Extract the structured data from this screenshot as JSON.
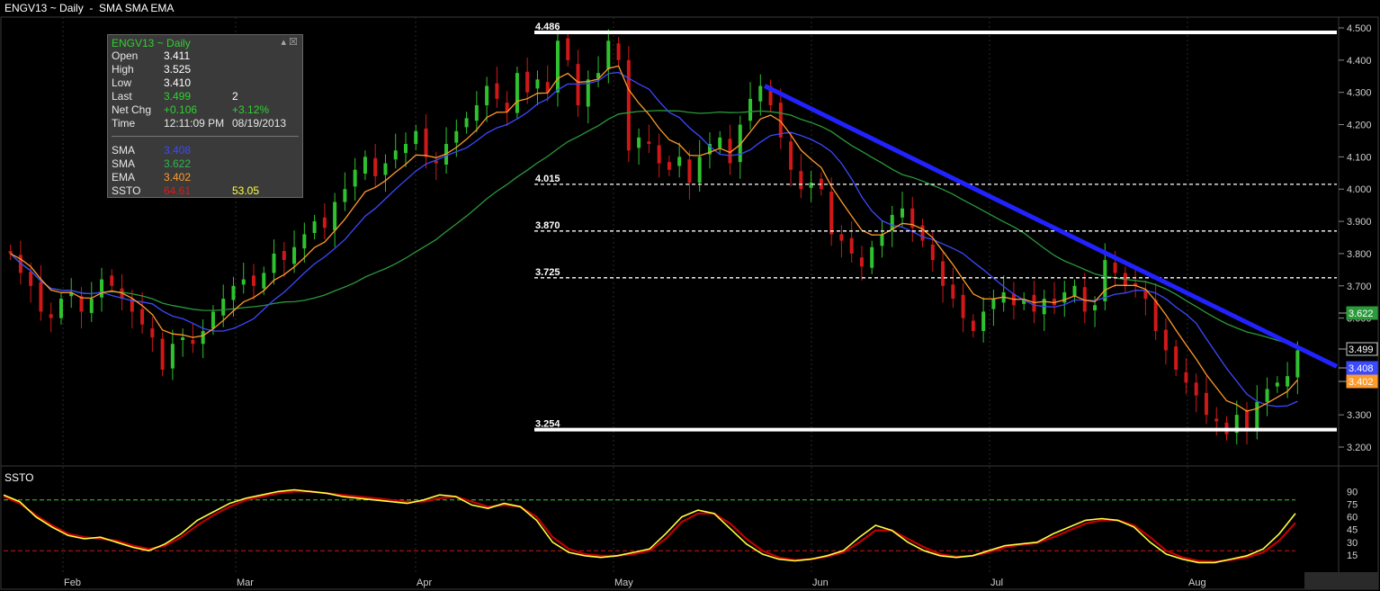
{
  "header": {
    "title": "ENGV13 ~ Daily  -  SMA SMA EMA"
  },
  "info_panel": {
    "title": "ENGV13 ~ Daily",
    "controls": "▴ ☒",
    "rows": [
      {
        "label": "Open",
        "value": "3.411",
        "extra": "",
        "color": "#ffffff"
      },
      {
        "label": "High",
        "value": "3.525",
        "extra": "",
        "color": "#ffffff"
      },
      {
        "label": "Low",
        "value": "3.410",
        "extra": "",
        "color": "#ffffff"
      },
      {
        "label": "Last",
        "value": "3.499",
        "extra": "2",
        "color": "#2fd02f"
      },
      {
        "label": "Net Chg",
        "value": "+0.106",
        "extra": "+3.12%",
        "color": "#2fd02f"
      },
      {
        "label": "Time",
        "value": "12:11:09 PM",
        "extra": "08/19/2013",
        "color": "#e6e6e6"
      }
    ],
    "studies": [
      {
        "label": "SMA",
        "value": "3.408",
        "extra": "",
        "color": "#3b49ff"
      },
      {
        "label": "SMA",
        "value": "3.622",
        "extra": "",
        "color": "#2fb84a"
      },
      {
        "label": "EMA",
        "value": "3.402",
        "extra": "",
        "color": "#ff9a2a"
      },
      {
        "label": "SSTO",
        "value": "64.61",
        "extra": "53.05",
        "color": "#e01818",
        "extra_color": "#ffff40"
      }
    ]
  },
  "subchart": {
    "title": "SSTO"
  },
  "colors": {
    "up": "#2fc22f",
    "down": "#d01818",
    "sma_fast": "#3b49ff",
    "sma_slow": "#2a9a3a",
    "ema": "#ff9a2a",
    "ssto_k": "#c00000",
    "ssto_d": "#ffff40",
    "trend": "#2222ff"
  },
  "chart_data": [
    {
      "type": "candlestick",
      "title": "ENGV13 ~ Daily",
      "x_labels": [
        "Feb",
        "Mar",
        "Apr",
        "May",
        "Jun",
        "Jul",
        "Aug"
      ],
      "ylim": [
        3.14,
        4.54
      ],
      "y_ticks": [
        "4.500",
        "4.400",
        "4.300",
        "4.200",
        "4.100",
        "4.000",
        "3.900",
        "3.800",
        "3.700",
        "3.600",
        "3.300",
        "3.200"
      ],
      "ohlc_close_approx": [
        3.8,
        3.74,
        3.7,
        3.62,
        3.6,
        3.66,
        3.68,
        3.62,
        3.66,
        3.72,
        3.7,
        3.66,
        3.62,
        3.58,
        3.54,
        3.44,
        3.52,
        3.54,
        3.52,
        3.56,
        3.62,
        3.66,
        3.7,
        3.72,
        3.7,
        3.74,
        3.8,
        3.78,
        3.82,
        3.86,
        3.9,
        3.88,
        3.96,
        4.0,
        4.06,
        4.1,
        4.04,
        4.08,
        4.12,
        4.14,
        4.18,
        4.1,
        4.08,
        4.14,
        4.18,
        4.22,
        4.26,
        4.32,
        4.28,
        4.24,
        4.36,
        4.3,
        4.34,
        4.3,
        4.46,
        4.4,
        4.26,
        4.34,
        4.36,
        4.46,
        4.4,
        4.12,
        4.16,
        4.14,
        4.08,
        4.06,
        4.1,
        4.02,
        4.1,
        4.14,
        4.16,
        4.08,
        4.2,
        4.28,
        4.32,
        4.26,
        4.16,
        4.06,
        4.0,
        4.02,
        4.0,
        3.86,
        3.84,
        3.8,
        3.76,
        3.82,
        3.86,
        3.92,
        3.94,
        3.88,
        3.84,
        3.78,
        3.7,
        3.66,
        3.6,
        3.56,
        3.62,
        3.66,
        3.68,
        3.64,
        3.66,
        3.62,
        3.66,
        3.64,
        3.68,
        3.7,
        3.62,
        3.64,
        3.78,
        3.74,
        3.7,
        3.7,
        3.66,
        3.56,
        3.5,
        3.44,
        3.4,
        3.36,
        3.3,
        3.28,
        3.24,
        3.3,
        3.26,
        3.34,
        3.38,
        3.4,
        3.42,
        3.5
      ],
      "series": [
        {
          "name": "SMA",
          "last": 3.408
        },
        {
          "name": "SMA",
          "last": 3.622
        },
        {
          "name": "EMA",
          "last": 3.402
        }
      ],
      "horizontal_levels": [
        {
          "value": 4.486,
          "label": "4.486",
          "style": "solid"
        },
        {
          "value": 4.015,
          "label": "4.015",
          "style": "dashed"
        },
        {
          "value": 3.87,
          "label": "3.870",
          "style": "dashed"
        },
        {
          "value": 3.725,
          "label": "3.725",
          "style": "dashed"
        },
        {
          "value": 3.254,
          "label": "3.254",
          "style": "solid"
        }
      ],
      "last_value_tags": [
        {
          "label": "3.622",
          "value": 3.622,
          "color": "#2a9a3a"
        },
        {
          "label": "3.499",
          "value": 3.499,
          "color": "#000000"
        },
        {
          "label": "3.408",
          "value": 3.408,
          "color": "#3b49ff"
        },
        {
          "label": "3.402",
          "value": 3.402,
          "color": "#ff9a2a"
        }
      ],
      "trendline": {
        "from": [
          "May",
          4.32
        ],
        "to": [
          "Aug",
          3.46
        ]
      }
    },
    {
      "type": "line",
      "title": "SSTO",
      "ylim": [
        0,
        100
      ],
      "y_ticks": [
        "90",
        "75",
        "60",
        "45",
        "30",
        "15"
      ],
      "reference_lines": [
        80,
        20
      ],
      "series": [
        {
          "name": "SSTO",
          "values": [
            86,
            78,
            60,
            48,
            38,
            34,
            36,
            30,
            24,
            20,
            28,
            40,
            56,
            66,
            76,
            82,
            86,
            90,
            92,
            90,
            88,
            84,
            82,
            80,
            78,
            76,
            80,
            86,
            84,
            74,
            70,
            76,
            72,
            56,
            30,
            18,
            14,
            12,
            14,
            18,
            22,
            40,
            60,
            68,
            64,
            46,
            28,
            16,
            10,
            8,
            10,
            14,
            20,
            36,
            50,
            44,
            30,
            20,
            14,
            12,
            14,
            20,
            26,
            28,
            30,
            40,
            48,
            56,
            58,
            56,
            48,
            30,
            16,
            10,
            6,
            6,
            10,
            14,
            22,
            40,
            64
          ]
        },
        {
          "name": "SSTO",
          "values": [
            84,
            76,
            62,
            50,
            40,
            36,
            34,
            32,
            26,
            22,
            26,
            36,
            50,
            62,
            72,
            80,
            84,
            88,
            90,
            90,
            88,
            86,
            84,
            82,
            80,
            78,
            78,
            82,
            84,
            78,
            72,
            74,
            72,
            60,
            36,
            22,
            16,
            14,
            14,
            16,
            20,
            34,
            54,
            64,
            64,
            52,
            34,
            20,
            12,
            9,
            10,
            13,
            18,
            30,
            44,
            44,
            34,
            24,
            16,
            13,
            14,
            18,
            24,
            27,
            29,
            36,
            44,
            52,
            56,
            56,
            50,
            36,
            20,
            12,
            8,
            7,
            9,
            12,
            18,
            32,
            53
          ]
        }
      ]
    }
  ]
}
